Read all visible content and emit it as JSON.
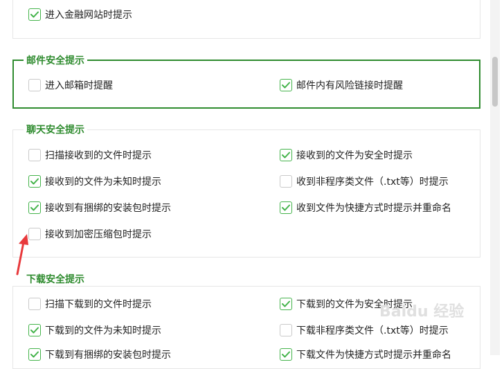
{
  "sections": {
    "finance": {
      "items": [
        {
          "label": "进入金融网站时提示",
          "checked": true
        }
      ]
    },
    "mail": {
      "title": "邮件安全提示",
      "items": [
        {
          "label": "进入邮箱时提醒",
          "checked": false
        },
        {
          "label": "邮件内有风险链接时提醒",
          "checked": true
        }
      ]
    },
    "chat": {
      "title": "聊天安全提示",
      "items": [
        {
          "label": "扫描接收到的文件时提示",
          "checked": false
        },
        {
          "label": "接收到的文件为安全时提示",
          "checked": true
        },
        {
          "label": "接收到的文件为未知时提示",
          "checked": true
        },
        {
          "label": "收到非程序类文件（.txt等）时提示",
          "checked": false
        },
        {
          "label": "接收到有捆绑的安装包时提示",
          "checked": true
        },
        {
          "label": "收到文件为快捷方式时提示并重命名",
          "checked": true
        },
        {
          "label": "接收到加密压缩包时提示",
          "checked": false
        }
      ]
    },
    "download": {
      "title": "下载安全提示",
      "items": [
        {
          "label": "扫描下载到的文件时提示",
          "checked": false
        },
        {
          "label": "下载到的文件为安全时提示",
          "checked": true
        },
        {
          "label": "下载到的文件为未知时提示",
          "checked": true
        },
        {
          "label": "下载非程序类文件（.txt等）时提示",
          "checked": false
        },
        {
          "label": "下载到有捆绑的安装包时提示",
          "checked": true
        },
        {
          "label": "下载文件为快捷方式时提示并重命名",
          "checked": true
        }
      ]
    }
  },
  "watermark": "Baidu 经验",
  "colors": {
    "accent": "#2e8b2e",
    "check": "#43b34a",
    "annotation_arrow": "#e8393c"
  }
}
